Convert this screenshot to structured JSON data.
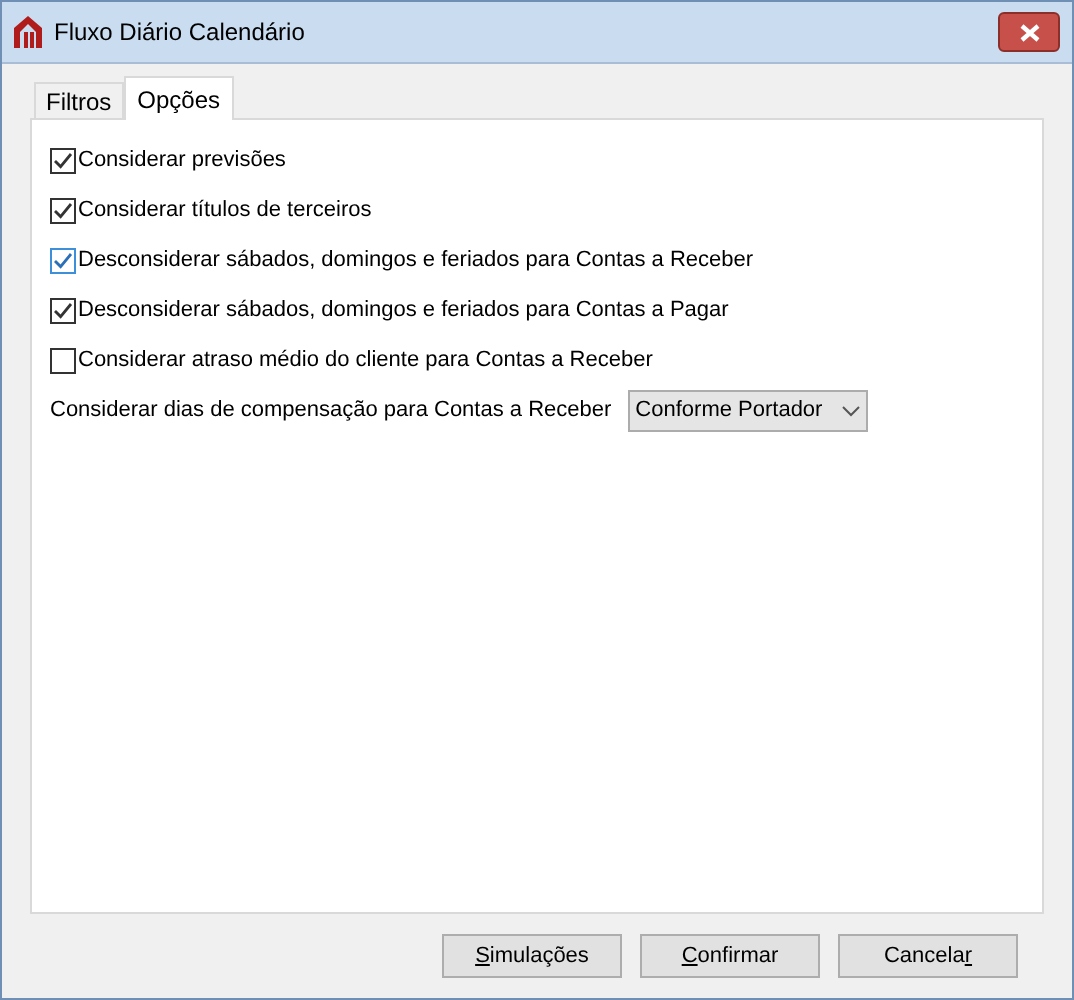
{
  "window": {
    "title": "Fluxo Diário Calendário"
  },
  "tabs": [
    {
      "label": "Filtros",
      "selected": false
    },
    {
      "label": "Opções",
      "selected": true
    }
  ],
  "options": [
    {
      "label": "Considerar previsões",
      "checked": true,
      "focused": false
    },
    {
      "label": "Considerar títulos de terceiros",
      "checked": true,
      "focused": false
    },
    {
      "label": "Desconsiderar sábados, domingos e feriados para Contas a Receber",
      "checked": true,
      "focused": true
    },
    {
      "label": "Desconsiderar sábados, domingos e feriados para Contas a Pagar",
      "checked": true,
      "focused": false
    },
    {
      "label": "Considerar atraso médio do cliente para Contas a Receber",
      "checked": false,
      "focused": false
    }
  ],
  "compensation": {
    "label": "Considerar dias de compensação para Contas a Receber",
    "value": "Conforme Portador"
  },
  "buttons": [
    {
      "access_key": "S",
      "label_after": "imulações"
    },
    {
      "access_key": "C",
      "label_after": "onfirmar"
    },
    {
      "label_before": "Cancela",
      "access_key": "r"
    }
  ]
}
